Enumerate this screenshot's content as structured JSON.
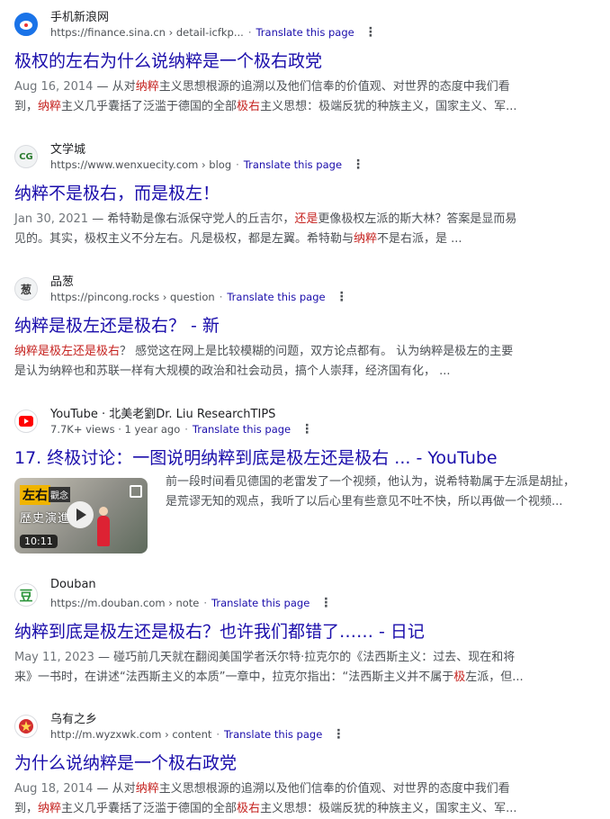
{
  "results": [
    {
      "site": "手机新浪网",
      "url": "https://finance.sina.cn › detail-icfkp...",
      "translate": "Translate this page",
      "title": "极权的左右为什么说纳粹是一个极右政党",
      "date": "Aug 16, 2014",
      "snip1a": " — 从对",
      "snip1hl": "纳粹",
      "snip1b": "主义思想根源的追溯以及他们信奉的价值观、对世界的态度中我们看",
      "snip2a": "到，",
      "snip2hl": "纳粹",
      "snip2b": "主义几乎囊括了泛滥于德国的全部",
      "snip2hl2": "极右",
      "snip2c": "主义思想：极端反犹的种族主义，国家主义、军..."
    },
    {
      "site": "文学城",
      "url": "https://www.wenxuecity.com › blog",
      "translate": "Translate this page",
      "title": "纳粹不是极右，而是极左！",
      "date": "Jan 30, 2021",
      "snip1a": " — 希特勒是像右派保守党人的丘吉尔，",
      "snip1hl": "还是",
      "snip1b": "更像极权左派的斯大林？答案是显而易",
      "snip2a": "见的。其实，极权主义不分左右。凡是极权，都是左翼。希特勒与",
      "snip2hl": "纳粹",
      "snip2b": "不是右派，是 ..."
    },
    {
      "site": "品葱",
      "url": "https://pincong.rocks › question",
      "translate": "Translate this page",
      "title": "纳粹是极左还是极右？ - 新",
      "snip1hl": "纳粹是极左还是极右",
      "snip1b": "？ 感觉这在网上是比较模糊的问题，双方论点都有。 认为纳粹是极左的主要",
      "snip2a": "是认为纳粹也和苏联一样有大规模的政治和社会动员，搞个人崇拜，经济国有化， ..."
    },
    {
      "site": "YouTube · 北美老劉Dr. Liu ResearchTIPS",
      "meta": "7.7K+ views · 1 year ago",
      "translate": "Translate this page",
      "title": "17. 终极讨论：一图说明纳粹到底是极左还是极右 ... - YouTube",
      "thumb_tag1": "左右",
      "thumb_tag2": "觀念",
      "thumb_tag3": "歷史演進",
      "duration": "10:11",
      "snip1": "前一段时间看见德国的老雷发了一个视频，他认为，说希特勒属于左派是胡扯，",
      "snip2": "是荒谬无知的观点，我听了以后心里有些意见不吐不快，所以再做一个视频..."
    },
    {
      "site": "Douban",
      "url": "https://m.douban.com › note",
      "translate": "Translate this page",
      "title": "纳粹到底是极左还是极右？也许我们都错了…… - 日记",
      "date": "May 11, 2023",
      "snip1a": " — 碰巧前几天就在翻阅美国学者沃尔特·拉克尔的《法西斯主义：过去、现在和将",
      "snip2a": "来》一书时，在讲述“法西斯主义的本质”一章中，拉克尔指出：“法西斯主义并不属于",
      "snip2hl": "极",
      "snip2b": "左派，但..."
    },
    {
      "site": "乌有之乡",
      "url": "http://m.wyzxwk.com › content",
      "translate": "Translate this page",
      "title": "为什么说纳粹是一个极右政党",
      "date": "Aug 18, 2014",
      "snip1a": " — 从对",
      "snip1hl": "纳粹",
      "snip1b": "主义思想根源的追溯以及他们信奉的价值观、对世界的态度中我们看",
      "snip2a": "到，",
      "snip2hl": "纳粹",
      "snip2b": "主义几乎囊括了泛滥于德国的全部",
      "snip2hl2": "极右",
      "snip2c": "主义思想：极端反犹的种族主义，国家主义、军..."
    }
  ],
  "favicons": [
    "sina-icon",
    "wenxuecity-icon",
    "pincong-icon",
    "youtube-icon",
    "douban-icon",
    "wyzxwk-icon"
  ],
  "colors": {
    "link": "#1a0dab",
    "highlight": "#c5221f",
    "text": "#4d5156"
  }
}
